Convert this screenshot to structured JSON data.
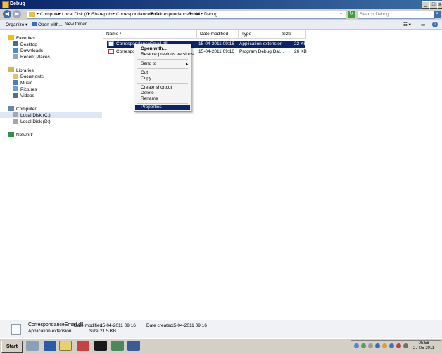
{
  "window": {
    "title": "Debug"
  },
  "address": {
    "crumbs": [
      "Computer",
      "Local Disk (C:)",
      "Sharepoint",
      "CorrespondanceEmail",
      "CorrespondanceEmail",
      "bin",
      "Debug"
    ],
    "search_placeholder": "Search Debug"
  },
  "commandbar": {
    "organize": "Organize",
    "open_with": "Open with...",
    "new_folder": "New folder"
  },
  "nav": {
    "favorites": "Favorites",
    "desktop": "Desktop",
    "downloads": "Downloads",
    "recent": "Recent Places",
    "libraries": "Libraries",
    "documents": "Documents",
    "music": "Music",
    "pictures": "Pictures",
    "videos": "Videos",
    "computer": "Computer",
    "local_c": "Local Disk (C:)",
    "local_d": "Local Disk (D:)",
    "network": "Network"
  },
  "columns": {
    "name": "Name",
    "date": "Date modified",
    "type": "Type",
    "size": "Size"
  },
  "files": [
    {
      "name": "CorrespondanceEmail.dll",
      "date": "15-04-2011 09:16",
      "type": "Application extension",
      "size": "22 KB"
    },
    {
      "name": "CorrespondanceEmail.pdb",
      "date": "15-04-2011 09:16",
      "type": "Program Debug Dat...",
      "size": "26 KB"
    }
  ],
  "context_menu": {
    "open_with": "Open with...",
    "restore": "Restore previous versions",
    "send_to": "Send to",
    "cut": "Cut",
    "copy": "Copy",
    "create_shortcut": "Create shortcut",
    "delete": "Delete",
    "rename": "Rename",
    "properties": "Properties"
  },
  "details": {
    "filename": "CorrespondanceEmail.dll",
    "date_modified_label": "Date modified:",
    "date_modified": "15-04-2011 09:16",
    "date_created_label": "Date created:",
    "date_created": "15-04-2011 09:16",
    "type": "Application extension",
    "size_label": "Size:",
    "size": "21.5 KB"
  },
  "taskbar": {
    "start": "Start",
    "time": "05:56",
    "date": "27-05-2011"
  }
}
